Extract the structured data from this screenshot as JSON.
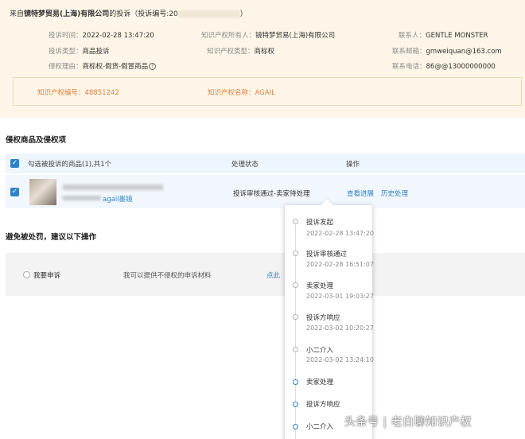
{
  "complaint": {
    "title_prefix": "来自",
    "company": "镜特梦贸易(上海)有限公司",
    "title_mid": "的投诉（投诉编号:20",
    "title_end": "）",
    "fields": {
      "time_label": "投诉时间：",
      "time_value": "2022-02-28 13:47:20",
      "owner_label": "知识产权所有人：",
      "owner_value": "镜特梦贸易(上海)有限公司",
      "contact_label": "联系人：",
      "contact_value": "GENTLE MONSTER",
      "type_label": "投诉类型：",
      "type_value": "商品投诉",
      "ip_type_label": "知识产权类型：",
      "ip_type_value": "商标权",
      "email_label": "联系邮箱：",
      "email_value": "gmweiquan@163.com",
      "reason_label": "侵权理由：",
      "reason_value": "商标权-假货-假冒商品",
      "phone_label": "联系电话：",
      "phone_value": "86@@13000000000"
    },
    "ip_box": {
      "number_label": "知识产权编号：",
      "number_value": "48851242",
      "name_label": "知识产权名称：",
      "name_value": "AGAIL"
    }
  },
  "goods_section": {
    "title": "侵权商品及侵权项",
    "header": {
      "select_label": "勾选被投诉的商品(1),共1个",
      "status_col": "处理状态",
      "action_col": "操作"
    },
    "row": {
      "product_tail": "agail墨镜",
      "status": "投诉审核通过-卖家待处理",
      "view_progress": "查看进展",
      "history": "历史处理"
    }
  },
  "penalty_section": {
    "title": "避免被处罚，建议以下操作",
    "appeal_label": "我要申诉",
    "appeal_desc": "我可以提供不侵权的申诉材料",
    "appeal_link": "点此"
  },
  "timeline": [
    {
      "label": "投诉发起",
      "time": "2022-02-28 13:47:20"
    },
    {
      "label": "投诉审核通过",
      "time": "2022-02-28 16:51:07"
    },
    {
      "label": "卖家处理",
      "time": "2022-03-01 19:03:27"
    },
    {
      "label": "投诉方响应",
      "time": "2022-03-02 10:20:27"
    },
    {
      "label": "小二介入",
      "time": "2022-03-02 13:24:10"
    },
    {
      "label": "卖家处理",
      "time": ""
    },
    {
      "label": "投诉方响应",
      "time": ""
    },
    {
      "label": "小二介入",
      "time": ""
    }
  ],
  "watermark": "头条号 | 老白聊知识产权",
  "colors": {
    "link_blue": "#2d82c8",
    "ip_orange": "#e0813a",
    "info_bg": "#fdf6e8"
  }
}
